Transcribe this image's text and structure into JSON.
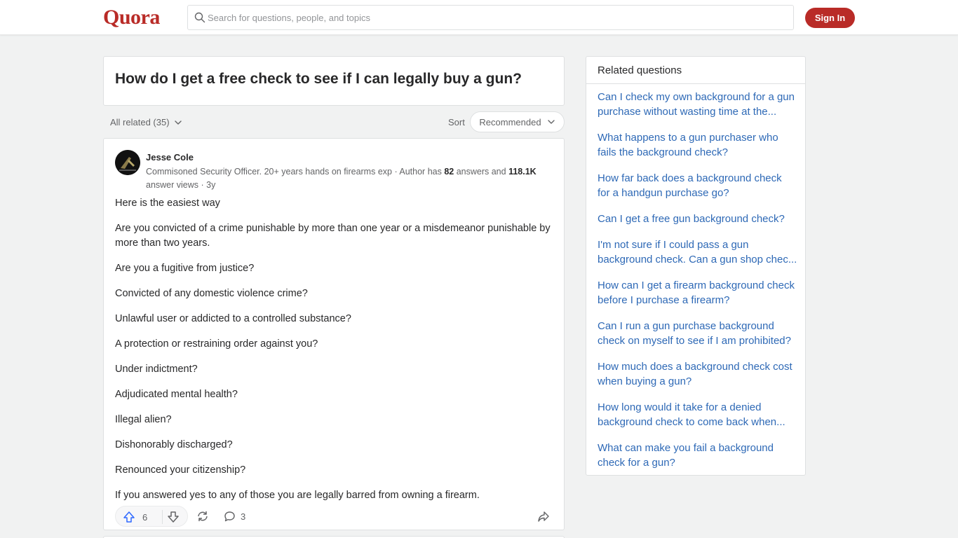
{
  "header": {
    "logo": "Quora",
    "search_placeholder": "Search for questions, people, and topics",
    "signin_label": "Sign In",
    "brand_color": "#b92b27"
  },
  "question": {
    "title": "How do I get a free check to see if I can legally buy a gun?"
  },
  "filters": {
    "all_related": "All related (35)",
    "sort_label": "Sort",
    "sort_value": "Recommended"
  },
  "answer": {
    "author": "Jesse Cole",
    "credential_prefix": "Commisoned Security Officer. 20+ years hands on firearms exp · Author has ",
    "answers_count": "82",
    "answers_mid": " answers and ",
    "views_count": "118.1K",
    "credential_suffix": " answer views · 3y",
    "paragraphs": [
      "Here is the easiest way",
      "Are you convicted of a crime punishable by more than one year or a misdemeanor punishable by more than two years.",
      "Are you a fugitive from justice?",
      "Convicted of any domestic violence crime?",
      "Unlawful user or addicted to a controlled substance?",
      "A protection or restraining order against you?",
      "Under indictment?",
      "Adjudicated mental health?",
      "Illegal alien?",
      "Dishonorably discharged?",
      "Renounced your citizenship?",
      "If you answered yes to any of those you are legally barred from owning a firearm."
    ],
    "upvotes": "6",
    "comments": "3"
  },
  "related": {
    "heading": "Related questions",
    "items": [
      {
        "line1": "Can I check my own background for a gun",
        "line2": "purchase without wasting time at the..."
      },
      {
        "line1": "What happens to a gun purchaser who",
        "line2": "fails the background check?"
      },
      {
        "line1": "How far back does a background check",
        "line2": "for a handgun purchase go?"
      },
      {
        "line1": "Can I get a free gun background check?",
        "line2": ""
      },
      {
        "line1": "I'm not sure if I could pass a gun",
        "line2": "background check. Can a gun shop chec..."
      },
      {
        "line1": "How can I get a firearm background check",
        "line2": "before I purchase a firearm?"
      },
      {
        "line1": "Can I run a gun purchase background",
        "line2": "check on myself to see if I am prohibited?"
      },
      {
        "line1": "How much does a background check cost",
        "line2": "when buying a gun?"
      },
      {
        "line1": "How long would it take for a denied",
        "line2": "background check to come back when..."
      },
      {
        "line1": "What can make you fail a background",
        "line2": "check for a gun?"
      }
    ]
  }
}
